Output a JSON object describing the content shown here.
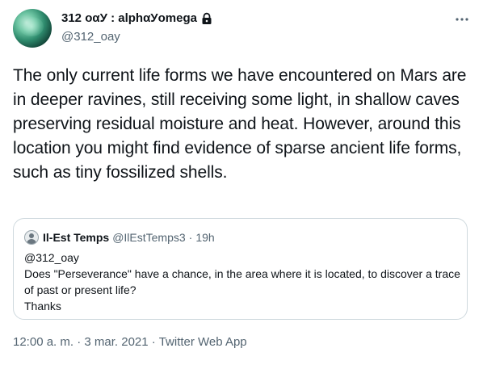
{
  "author": {
    "display_name": "312 οαУ : alphαУomega",
    "handle": "@312_oay"
  },
  "tweet": {
    "text": "The only current life forms we have encountered on Mars are in deeper ravines, still receiving some light, in shallow caves preserving residual moisture and heat. However, around this location you might find evidence of sparse ancient life forms, such as tiny fossilized shells."
  },
  "quoted_tweet": {
    "display_name": "Il-Est Temps",
    "handle": "@IlEstTemps3",
    "separator": "·",
    "time": "19h",
    "lines": [
      "@312_oay",
      "Does \"Perseverance\" have a chance, in the area where it is located, to discover a trace of past or present life?",
      "Thanks"
    ]
  },
  "meta": {
    "time": "12:00 a. m.",
    "separator": "·",
    "date": "3 mar. 2021",
    "source": "Twitter Web App"
  },
  "icons": {
    "lock": "lock-icon",
    "more": "more-horizontal-icon"
  },
  "colors": {
    "text": "#0f1419",
    "secondary": "#536471",
    "border": "#cfd9de"
  }
}
